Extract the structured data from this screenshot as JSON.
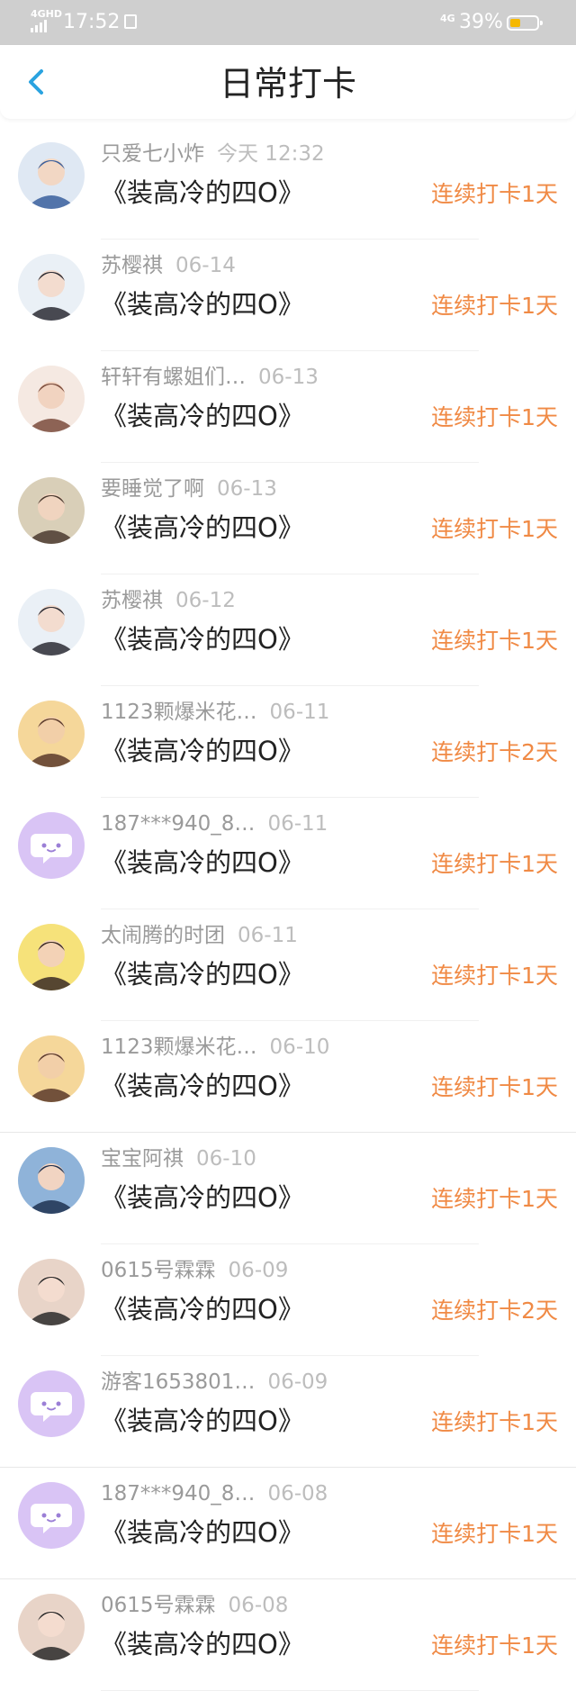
{
  "status_bar": {
    "network": "4GHD",
    "time": "17:52",
    "network2": "4G",
    "battery_percent": "39%",
    "battery_level": 0.39,
    "battery_color": "#f5b800"
  },
  "header": {
    "title": "日常打卡",
    "back_icon": "chevron-left-icon",
    "accent": "#2aa3e0"
  },
  "records": [
    {
      "name": "只爱七小炸",
      "date": "今天 12:32",
      "content": "《装高冷的四O》",
      "streak": "连续打卡1天",
      "avatar": "photo"
    },
    {
      "name": "苏樱祺",
      "date": "06-14",
      "content": "《装高冷的四O》",
      "streak": "连续打卡1天",
      "avatar": "photo"
    },
    {
      "name": "轩轩有螺姐们…",
      "date": "06-13",
      "content": "《装高冷的四O》",
      "streak": "连续打卡1天",
      "avatar": "photo"
    },
    {
      "name": "要睡觉了啊",
      "date": "06-13",
      "content": "《装高冷的四O》",
      "streak": "连续打卡1天",
      "avatar": "photo"
    },
    {
      "name": "苏樱祺",
      "date": "06-12",
      "content": "《装高冷的四O》",
      "streak": "连续打卡1天",
      "avatar": "photo"
    },
    {
      "name": "1123颗爆米花…",
      "date": "06-11",
      "content": "《装高冷的四O》",
      "streak": "连续打卡2天",
      "avatar": "photo"
    },
    {
      "name": "187***940_8…",
      "date": "06-11",
      "content": "《装高冷的四O》",
      "streak": "连续打卡1天",
      "avatar": "default"
    },
    {
      "name": "太闹腾的时团",
      "date": "06-11",
      "content": "《装高冷的四O》",
      "streak": "连续打卡1天",
      "avatar": "photo"
    },
    {
      "name": "1123颗爆米花…",
      "date": "06-10",
      "content": "《装高冷的四O》",
      "streak": "连续打卡1天",
      "avatar": "photo"
    },
    {
      "name": "宝宝阿祺",
      "date": "06-10",
      "content": "《装高冷的四O》",
      "streak": "连续打卡1天",
      "avatar": "photo"
    },
    {
      "name": "0615号霖霖",
      "date": "06-09",
      "content": "《装高冷的四O》",
      "streak": "连续打卡2天",
      "avatar": "photo"
    },
    {
      "name": "游客1653801…",
      "date": "06-09",
      "content": "《装高冷的四O》",
      "streak": "连续打卡1天",
      "avatar": "default"
    },
    {
      "name": "187***940_8…",
      "date": "06-08",
      "content": "《装高冷的四O》",
      "streak": "连续打卡1天",
      "avatar": "default"
    },
    {
      "name": "0615号霖霖",
      "date": "06-08",
      "content": "《装高冷的四O》",
      "streak": "连续打卡1天",
      "avatar": "photo"
    }
  ],
  "colors": {
    "streak": "#f08a45",
    "default_avatar": "#d9c4f5"
  }
}
